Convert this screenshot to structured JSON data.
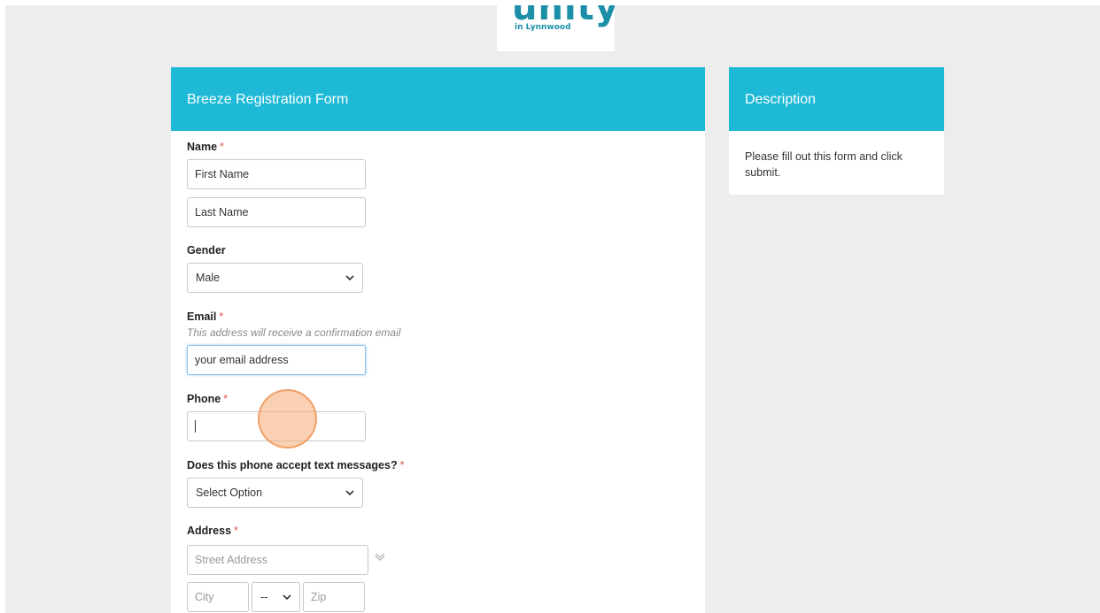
{
  "logo": {
    "word": "unity",
    "sub": "in Lynnwood"
  },
  "form_panel": {
    "title": "Breeze Registration Form"
  },
  "side_panel": {
    "title": "Description",
    "text": "Please fill out this form and click submit."
  },
  "fields": {
    "name": {
      "label": "Name",
      "required": "*",
      "first_value": "First Name",
      "last_value": "Last Name"
    },
    "gender": {
      "label": "Gender",
      "selected": "Male"
    },
    "email": {
      "label": "Email",
      "required": "*",
      "hint": "This address will receive a confirmation email",
      "value": "your email address"
    },
    "phone": {
      "label": "Phone",
      "required": "*",
      "value": ""
    },
    "text_messages": {
      "label": "Does this phone accept text messages?",
      "required": "*",
      "selected": "Select Option"
    },
    "address": {
      "label": "Address",
      "required": "*",
      "street_placeholder": "Street Address",
      "city_placeholder": "City",
      "state_selected": "--",
      "zip_placeholder": "Zip"
    }
  },
  "colors": {
    "accent": "#1eb9d6",
    "required": "#d9534f",
    "background": "#ededee",
    "click_indicator": "#f7b080"
  },
  "icons": [
    "chevron-down-icon",
    "expand-chevron-icon",
    "click-indicator"
  ]
}
